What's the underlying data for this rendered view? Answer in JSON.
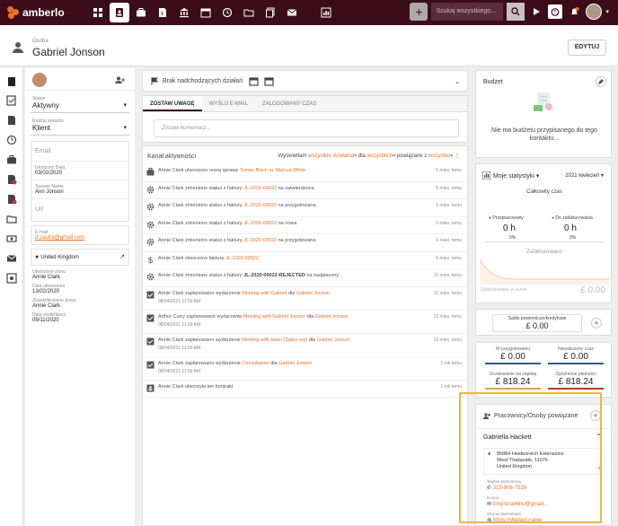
{
  "app": {
    "logo": "amberlo",
    "search_placeholder": "Szukaj wszystkiego..."
  },
  "header": {
    "subtitle": "Osoba",
    "name": "Gabriel Jonson",
    "edit_label": "EDYTUJ"
  },
  "left": {
    "status_label": "Status",
    "status_value": "Aktywny",
    "relation_label": "Rodzaj związku",
    "relation_value": "Klient",
    "email_placeholder": "Email",
    "birth_label": "Urodzony Data",
    "birth_value": "03/02/2020",
    "spouse_label": "Spouse Name",
    "spouse_value": "Ann Jonson",
    "url_placeholder": "Url",
    "email2_label": "E-mail",
    "email2_value": "d.zautra@gmail.com",
    "country": "United Kingdom",
    "created_by_label": "Utworzone przez",
    "created_by": "Annie Clark",
    "created_date_label": "Data utworzenia",
    "created_date": "13/02/2020",
    "modified_by_label": "Zmodyfikowane przez",
    "modified_by": "Annie Clark",
    "modified_date_label": "Data modyfikacji",
    "modified_date": "09/11/2020"
  },
  "center": {
    "deadlines": "Brak nadchodzących działań",
    "tabs": [
      "ZOSTAW UWAGĘ",
      "WYŚLIJ E-MAIL",
      "ZALOGOWANY CZAS"
    ],
    "comment_placeholder": "Zostaw komentarz...",
    "feed_title": "Kanał aktywności",
    "filter": {
      "pre": "Wyświetlam",
      "a": "wszystkie działania",
      "mid": "dla",
      "b": "wszystkich",
      "mid2": "powiązane z",
      "c": "wszystko"
    },
    "activities": [
      {
        "icon": "briefcase-icon",
        "pre": "Annie Clark utworzono nową sprawę",
        "link": "Tomas Black vs Marcus White",
        "post": "",
        "time": "5 mies. temu",
        "date": ""
      },
      {
        "icon": "gear-icon",
        "pre": "Annie Clark zmieniono status z faktury",
        "link": "JL-2020-00022",
        "post": "na zatwierdzona",
        "time": "5 mies. temu",
        "date": ""
      },
      {
        "icon": "gear-icon",
        "pre": "Annie Clark zmieniono status z faktury",
        "link": "JL-2020-00022",
        "post": "na przygotowana",
        "time": "6 mies. temu",
        "date": ""
      },
      {
        "icon": "gear-icon",
        "pre": "Annie Clark zmieniono status z faktury",
        "link": "JL-2020-00022",
        "post": "na nowa",
        "time": "6 mies. temu",
        "date": ""
      },
      {
        "icon": "gear-icon",
        "pre": "Annie Clark zmieniono status z faktury",
        "link": "JL-2020-00022",
        "post": "na przygotowana",
        "time": "6 mies. temu",
        "date": ""
      },
      {
        "icon": "dollar-icon",
        "pre": "Annie Clark stworzono fakturę",
        "link": "JL-2020-00022",
        "post": "",
        "time": "6 mies. temu",
        "date": ""
      },
      {
        "icon": "gear-icon",
        "pre": "Annie Clark zmieniono status z faktury",
        "bold": "JL-2020-00022-REJECTED",
        "post": "na nadpłacony",
        "time": "11 mies. temu",
        "date": ""
      },
      {
        "icon": "calendar-check-icon",
        "pre": "Annie Clark zaplanowano wydarzenie",
        "link": "Meeting with Gabriel",
        "post": "dla",
        "link2": "Gabriel Jonson",
        "time": "11 mies. temu",
        "date": "08/04/2021 11:59 AM"
      },
      {
        "icon": "calendar-check-icon",
        "pre": "Arthur Curry zaplanowano wydarzenie",
        "link": "Meeting with Gabriel Jonson",
        "post": "dla",
        "link2": "Gabriel Jonson",
        "time": "12 mies. temu",
        "date": "08/04/2021 11:59 AM"
      },
      {
        "icon": "calendar-check-icon",
        "pre": "Annie Clark zaplanowano wydarzenie",
        "link": "Meeting with team (Sales rep)",
        "post": "dla",
        "link2": "Gabriel Jonson",
        "time": "12 mies. temu",
        "date": "08/04/2021 11:59 AM"
      },
      {
        "icon": "calendar-check-icon",
        "pre": "Annie Clark zaplanowano wydarzenie",
        "link": "Consultation",
        "post": "dla",
        "link2": "Gabriel Jonson",
        "time": "1 rok temu",
        "date": "08/04/2021 11:59 AM"
      },
      {
        "icon": "contact-card-icon",
        "pre": "Annie Clark utworzyła ten kontrakt",
        "link": "",
        "post": "",
        "time": "1 rok temu",
        "date": ""
      }
    ]
  },
  "right": {
    "budget_title": "Budżet",
    "budget_empty": "Nie ma budżetu przypisanego do tego kontaktu...",
    "stats_title": "Moje statystyki",
    "stats_period": "2021 kwiecień",
    "total_time": "Całkowity czas",
    "prepared_label": "Przepracowany",
    "prepared_value": "0 h",
    "prepared_pct": "0%",
    "tobill_label": "Do zafakturowania",
    "tobill_value": "0 h",
    "tobill_pct": "0%",
    "invoiced_label": "Zafakturowano",
    "invoiced_total_label": "Zafakturowano w sumie",
    "invoiced_total_value": "£ 0.00",
    "balance_label": "Saldo powiernicze/kredytowe",
    "balance_value": "£ 0.00",
    "kpis": [
      {
        "label": "W przygotowaniu",
        "value": "£ 0.00",
        "color": "#2b5b8a"
      },
      {
        "label": "Niezaliczony czas",
        "value": "£ 0.00",
        "color": "#2b5b8a"
      },
      {
        "label": "Oczekiwanie na zapłatę",
        "value": "£ 818.24",
        "color": "#e8a23a"
      },
      {
        "label": "Opóźnione płatności",
        "value": "£ 818.24",
        "color": "#c0392b"
      }
    ],
    "related_title": "Pracownicy/Osoby powiązane",
    "contact_name": "Gabriella Hackett",
    "address_lines": [
      "85884 Heidenreich Extensions",
      "West Thaliaside, 11076",
      "United Kingdom"
    ],
    "work_phone_label": "Telefon komórkowy",
    "work_phone": "315-806-7529",
    "email_label": "E-mail",
    "email": "tony.torantino@gmail...",
    "website_label": "Strona internetowa",
    "website": "https://shaned.name"
  },
  "colors": {
    "brand": "#3b0d1b",
    "accent": "#f37021",
    "highlight": "#e8b84a"
  }
}
